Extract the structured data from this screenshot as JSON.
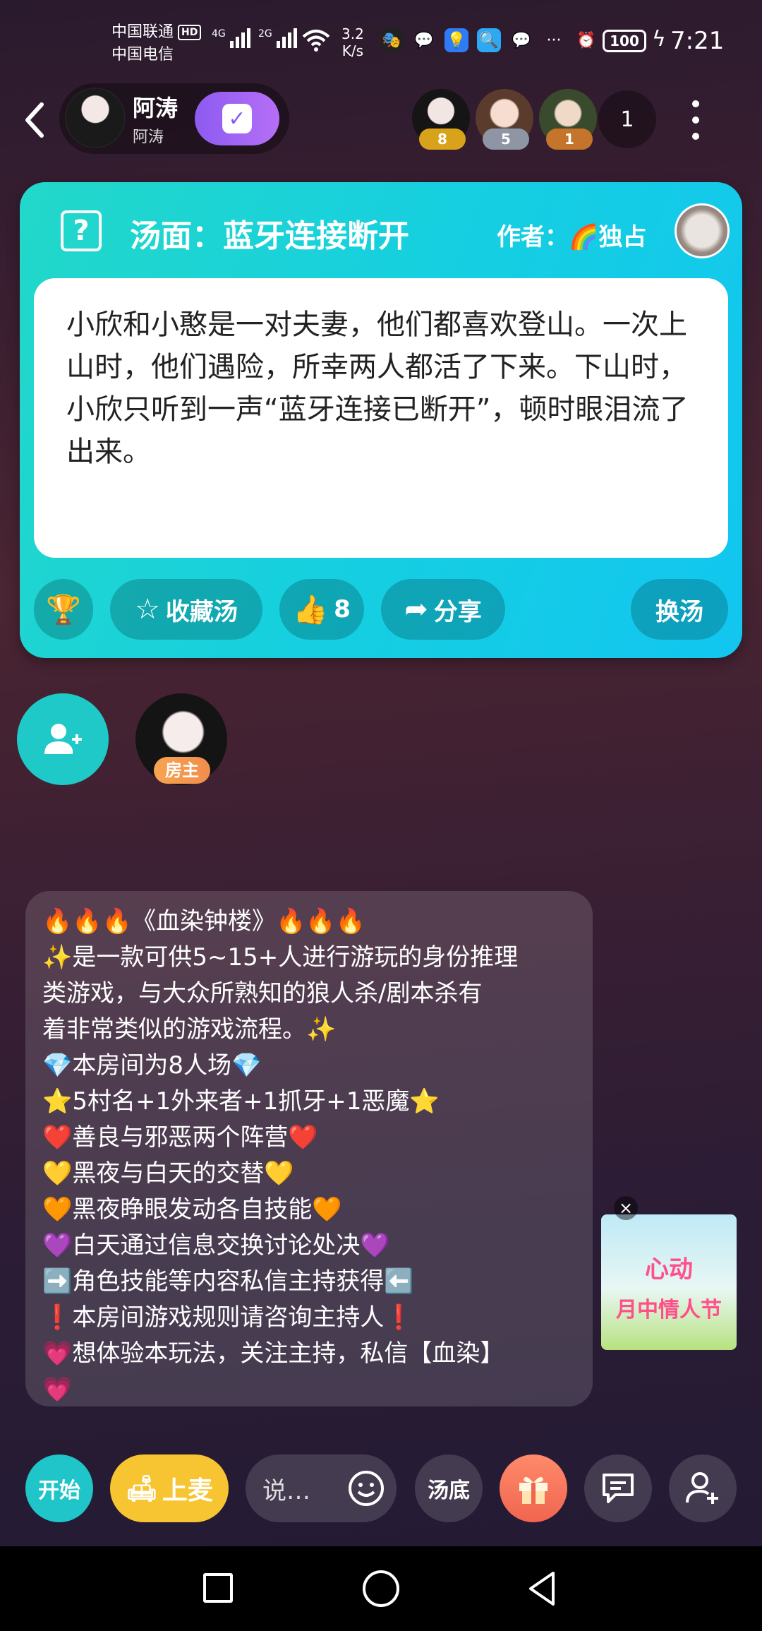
{
  "status_bar": {
    "carrier1": "中国联通",
    "hd": "HD",
    "carrier2": "中国电信",
    "net1": "4G",
    "net2": "2G",
    "speed_value": "3.2",
    "speed_unit": "K/s",
    "battery": "100",
    "time": "7:21"
  },
  "header": {
    "host_name": "阿涛",
    "host_subtitle": "阿涛",
    "audience": [
      {
        "badge": "8",
        "badge_color": "#d9a21b"
      },
      {
        "badge": "5",
        "badge_color": "#8e96a6"
      },
      {
        "badge": "1",
        "badge_color": "#c4742b"
      }
    ],
    "audience_count": "1"
  },
  "soup_card": {
    "title": "汤面：蓝牙连接断开",
    "author_label": "作者：",
    "author_name": "🌈独占",
    "body": "小欣和小憨是一对夫妻，他们都喜欢登山。一次上山时，他们遇险，所幸两人都活了下来。下山时，小欣只听到一声“蓝牙连接已断开”，顿时眼泪流了出来。",
    "actions": {
      "collect": "收藏汤",
      "likes": "8",
      "share": "分享",
      "change": "换汤"
    }
  },
  "seats": {
    "host_tag": "房主"
  },
  "announcement": [
    "🔥🔥🔥《血染钟楼》🔥🔥🔥",
    "✨是一款可供5~15+人进行游玩的身份推理",
    "类游戏，与大众所熟知的狼人杀/剧本杀有",
    "着非常类似的游戏流程。✨",
    "💎本房间为8人场💎",
    "⭐5村名+1外来者+1抓牙+1恶魔⭐",
    "❤️善良与邪恶两个阵营❤️",
    "💛黑夜与白天的交替💛",
    "🧡黑夜睁眼发动各自技能🧡",
    "💜白天通过信息交换讨论处决💜",
    "➡️角色技能等内容私信主持获得⬅️",
    "❗本房间游戏规则请咨询主持人❗",
    "💗想体验本玩法，关注主持，私信【血染】",
    "💗"
  ],
  "promo": {
    "line1": "心动",
    "line2": "月中情人节"
  },
  "toolbar": {
    "start": "开始",
    "mic": "上麦",
    "say_placeholder": "说…",
    "soup_answer": "汤底"
  }
}
